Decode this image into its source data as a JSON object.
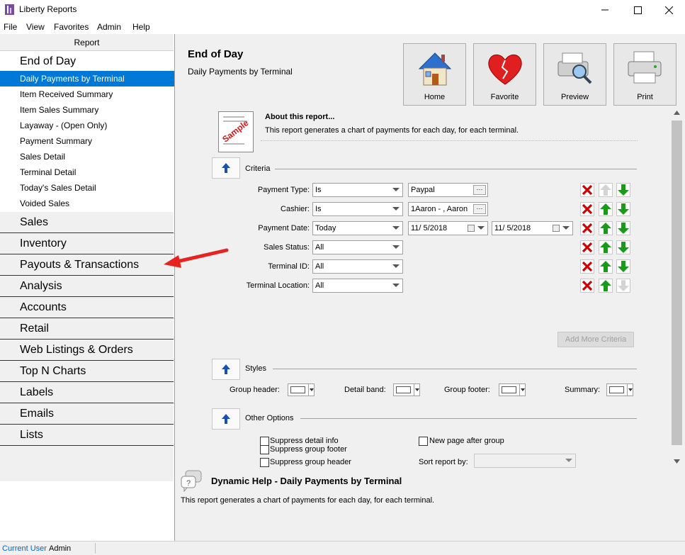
{
  "window": {
    "title": "Liberty Reports"
  },
  "menu": [
    "File",
    "View",
    "Favorites",
    "Admin",
    "Help"
  ],
  "left": {
    "header": "Report",
    "groups": [
      {
        "label": "End of Day",
        "items": [
          "Daily Payments by Terminal",
          "Item Received Summary",
          "Item Sales Summary",
          "Layaway - (Open Only)",
          "Payment Summary",
          "Sales Detail",
          "Terminal Detail",
          "Today's Sales Detail",
          "Voided Sales"
        ]
      },
      {
        "label": "Sales"
      },
      {
        "label": "Inventory"
      },
      {
        "label": "Payouts & Transactions"
      },
      {
        "label": "Analysis"
      },
      {
        "label": "Accounts"
      },
      {
        "label": "Retail"
      },
      {
        "label": "Web Listings & Orders"
      },
      {
        "label": "Top N Charts"
      },
      {
        "label": "Labels"
      },
      {
        "label": "Emails"
      },
      {
        "label": "Lists"
      }
    ]
  },
  "header": {
    "title": "End of Day",
    "subtitle": "Daily Payments by Terminal"
  },
  "toolbar": {
    "home": "Home",
    "favorite": "Favorite",
    "preview": "Preview",
    "print": "Print"
  },
  "about": {
    "icon_text": "Sample",
    "title": "About this report...",
    "text": "This report generates a chart of payments for each day, for each terminal."
  },
  "criteria": {
    "section_label": "Criteria",
    "rows": [
      {
        "label": "Payment Type:",
        "op": "Is",
        "value": "Paypal"
      },
      {
        "label": "Cashier:",
        "op": "Is",
        "value": "1Aaron - , Aaron"
      },
      {
        "label": "Payment Date:",
        "op": "Today",
        "date_from": "11/  5/2018",
        "date_to": "11/  5/2018"
      },
      {
        "label": "Sales Status:",
        "op": "All"
      },
      {
        "label": "Terminal ID:",
        "op": "All"
      },
      {
        "label": "Terminal Location:",
        "op": "All"
      }
    ],
    "add_more": "Add More Criteria"
  },
  "styles": {
    "section_label": "Styles",
    "group_header": "Group header:",
    "detail_band": "Detail band:",
    "group_footer": "Group footer:",
    "summary": "Summary:"
  },
  "other": {
    "section_label": "Other Options",
    "suppress_detail": "Suppress detail info",
    "suppress_group_header": "Suppress group header",
    "suppress_group_footer": "Suppress group footer",
    "new_page_after_group": "New page after group",
    "sort_by": "Sort report by:"
  },
  "help": {
    "title": "Dynamic Help - Daily Payments by Terminal",
    "text": "This report generates a chart of payments for each day, for each terminal."
  },
  "status": {
    "label": "Current User",
    "user": "Admin"
  },
  "colors": {
    "selection": "#0078d7",
    "link": "#0066cc",
    "delete": "#d00000",
    "move": "#1a9a1a"
  }
}
